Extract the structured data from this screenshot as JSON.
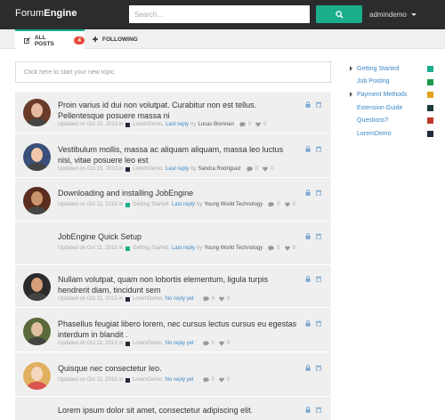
{
  "brand": {
    "name_regular": "Forum",
    "name_bold": "Engine"
  },
  "search": {
    "placeholder": "Search..."
  },
  "user": {
    "name": "admindemo"
  },
  "tabs": [
    {
      "label": "ALL POSTS",
      "count": "4"
    },
    {
      "label": "FOLLOWING"
    }
  ],
  "new_topic": {
    "placeholder": "Click here to start your new topic"
  },
  "threads": [
    {
      "title": "Proin varius id dui non volutpat. Curabitur non est tellus. Pellentesque posuere massa ni",
      "updated": "Updated on Oct 15, 2013 in",
      "category": "LoremDemo.",
      "category_color": "#222a3a",
      "reply_prefix": "Last reply",
      "by": "by",
      "author": "Lucas Brennan",
      "comments": "0",
      "likes": "0"
    },
    {
      "title": "Vestibulum mollis, massa ac aliquam aliquam, massa leo luctus nisi, vitae posuere leo est",
      "updated": "Updated on Oct 15, 2013 in",
      "category": "LoremDemo.",
      "category_color": "#222a3a",
      "reply_prefix": "Last reply",
      "by": "by",
      "author": "Sandra Rodriguez",
      "comments": "0",
      "likes": "0"
    },
    {
      "title": "Downloading and installing JobEngine",
      "updated": "Updated on Oct 11, 2013 in",
      "category": "Getting Started.",
      "category_color": "#1aae8c",
      "reply_prefix": "Last reply",
      "by": "by",
      "author": "Young World Technology",
      "comments": "0",
      "likes": "0"
    },
    {
      "title": "JobEngine Quick Setup",
      "updated": "Updated on Oct 11, 2013 in",
      "category": "Getting Started.",
      "category_color": "#1aae8c",
      "reply_prefix": "Last reply",
      "by": "by",
      "author": "Young World Technology",
      "comments": "5",
      "likes": "0"
    },
    {
      "title": "Nullam volutpat, quam non lobortis elementum, ligula turpis hendrerit diam, tincidunt sem",
      "updated": "Updated on Oct 11, 2013 in",
      "category": "LoremDemo.",
      "category_color": "#222a3a",
      "reply_prefix": "No reply yet",
      "by": "",
      "author": "",
      "comments": "0",
      "likes": "0"
    },
    {
      "title": "Phasellus feugiat libero lorem, nec cursus lectus cursus eu egestas interdum in blandit .",
      "updated": "Updated on Oct 11, 2013 in",
      "category": "LoremDemo.",
      "category_color": "#222a3a",
      "reply_prefix": "No reply yet",
      "by": "",
      "author": "",
      "comments": "0",
      "likes": "0"
    },
    {
      "title": "Quisque nec consectetur leo.",
      "updated": "Updated on Oct 11, 2013 in",
      "category": "LoremDemo.",
      "category_color": "#222a3a",
      "reply_prefix": "No reply yet",
      "by": "",
      "author": "",
      "comments": "0",
      "likes": "0"
    },
    {
      "title": "Lorem ipsum dolor sit amet, consectetur adipiscing elit.",
      "updated": "",
      "category": "",
      "category_color": "#222a3a",
      "reply_prefix": "",
      "by": "",
      "author": "",
      "comments": "",
      "likes": ""
    }
  ],
  "categories": [
    {
      "label": "Getting Started",
      "color": "#1aae8c"
    },
    {
      "label": "Job Posting",
      "color": "#1f9a4a"
    },
    {
      "label": "Payment Methods",
      "color": "#e0a21a"
    },
    {
      "label": "Extension Guide",
      "color": "#1c3a3a"
    },
    {
      "label": "Questions?",
      "color": "#c0392b"
    },
    {
      "label": "LoremDemo",
      "color": "#222a3a"
    }
  ],
  "colors": {
    "accent": "#1aae8c",
    "topbar": "#2b2c2d",
    "link": "#3b86c6",
    "badge": "#e14b3b"
  }
}
